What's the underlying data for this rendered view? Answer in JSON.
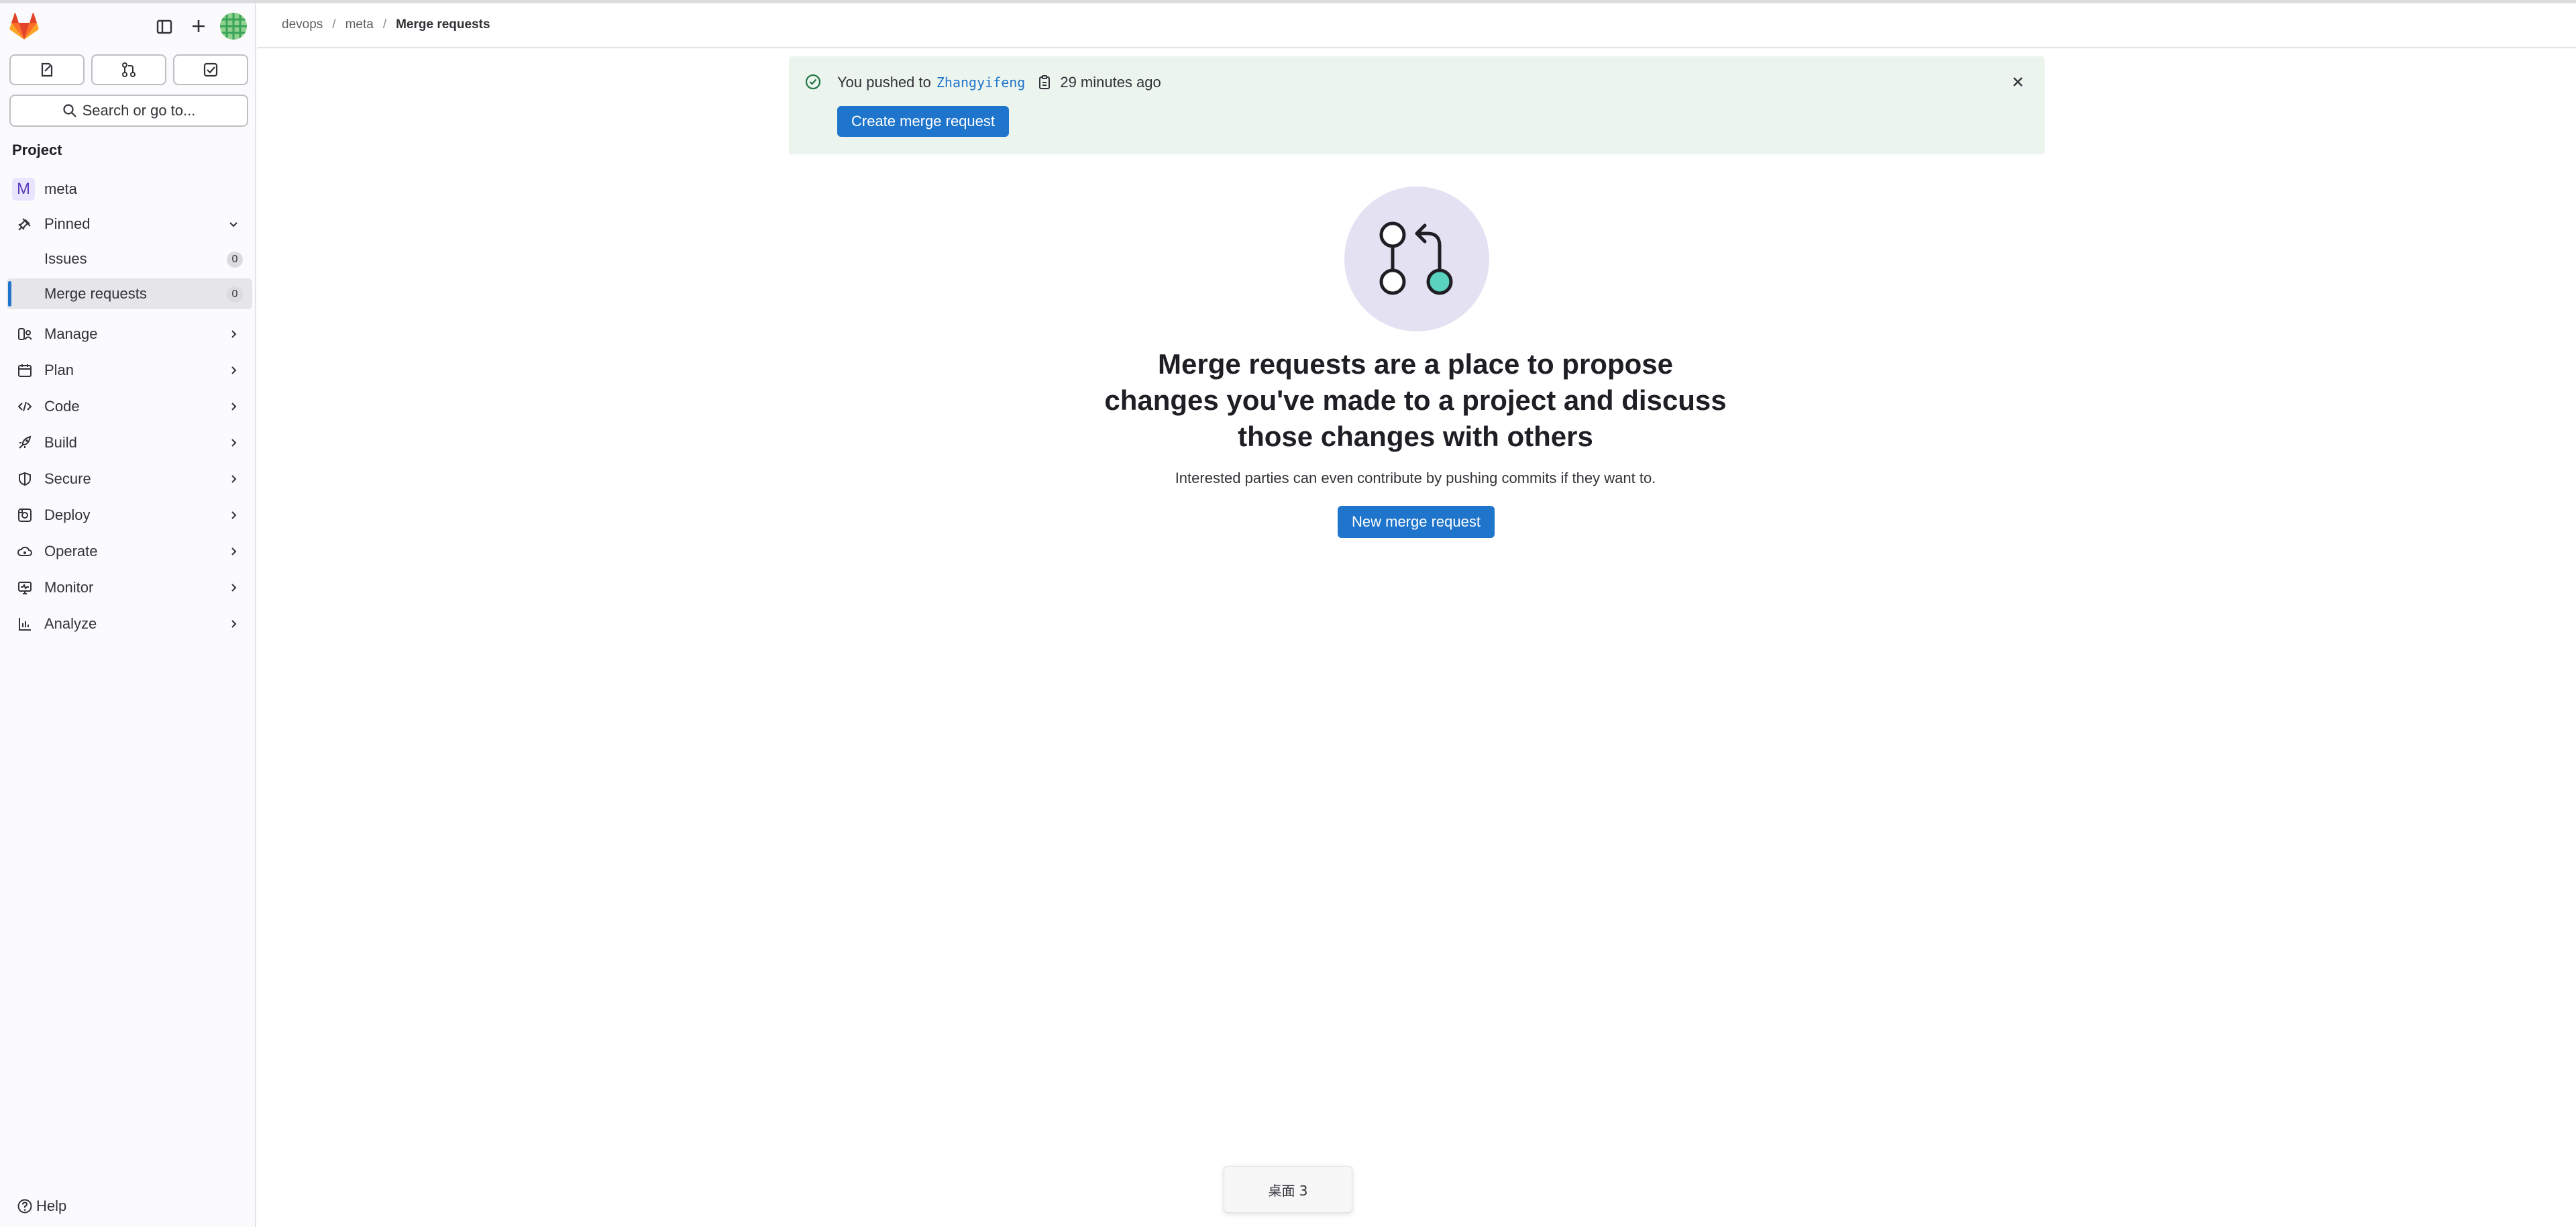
{
  "sidebar": {
    "heading": "Project",
    "search_label": "Search or go to...",
    "project": {
      "initial": "M",
      "name": "meta"
    },
    "pinned_label": "Pinned",
    "pinned_items": [
      {
        "label": "Issues",
        "count": "0"
      },
      {
        "label": "Merge requests",
        "count": "0"
      }
    ],
    "menu": [
      {
        "label": "Manage",
        "icon": "manage-icon"
      },
      {
        "label": "Plan",
        "icon": "plan-icon"
      },
      {
        "label": "Code",
        "icon": "code-icon"
      },
      {
        "label": "Build",
        "icon": "rocket-icon"
      },
      {
        "label": "Secure",
        "icon": "shield-icon"
      },
      {
        "label": "Deploy",
        "icon": "deploy-icon"
      },
      {
        "label": "Operate",
        "icon": "cloud-icon"
      },
      {
        "label": "Monitor",
        "icon": "monitor-icon"
      },
      {
        "label": "Analyze",
        "icon": "chart-icon"
      }
    ],
    "help_label": "Help"
  },
  "breadcrumb": [
    "devops",
    "meta",
    "Merge requests"
  ],
  "alert": {
    "prefix": "You pushed to",
    "branch": "Zhangyifeng",
    "time": "29 minutes ago",
    "button": "Create merge request"
  },
  "empty_state": {
    "title": "Merge requests are a place to propose changes you've made to a project and discuss those changes with others",
    "description": "Interested parties can even contribute by pushing commits if they want to.",
    "button": "New merge request"
  },
  "workspace_toast": "桌面 3",
  "colors": {
    "primary": "#1f75cb",
    "alert_bg": "#ecf4ee",
    "illustration_bg": "#e4e1f3",
    "accent_teal": "#5ad2c0",
    "sidebar_bg": "#fbfafd"
  }
}
